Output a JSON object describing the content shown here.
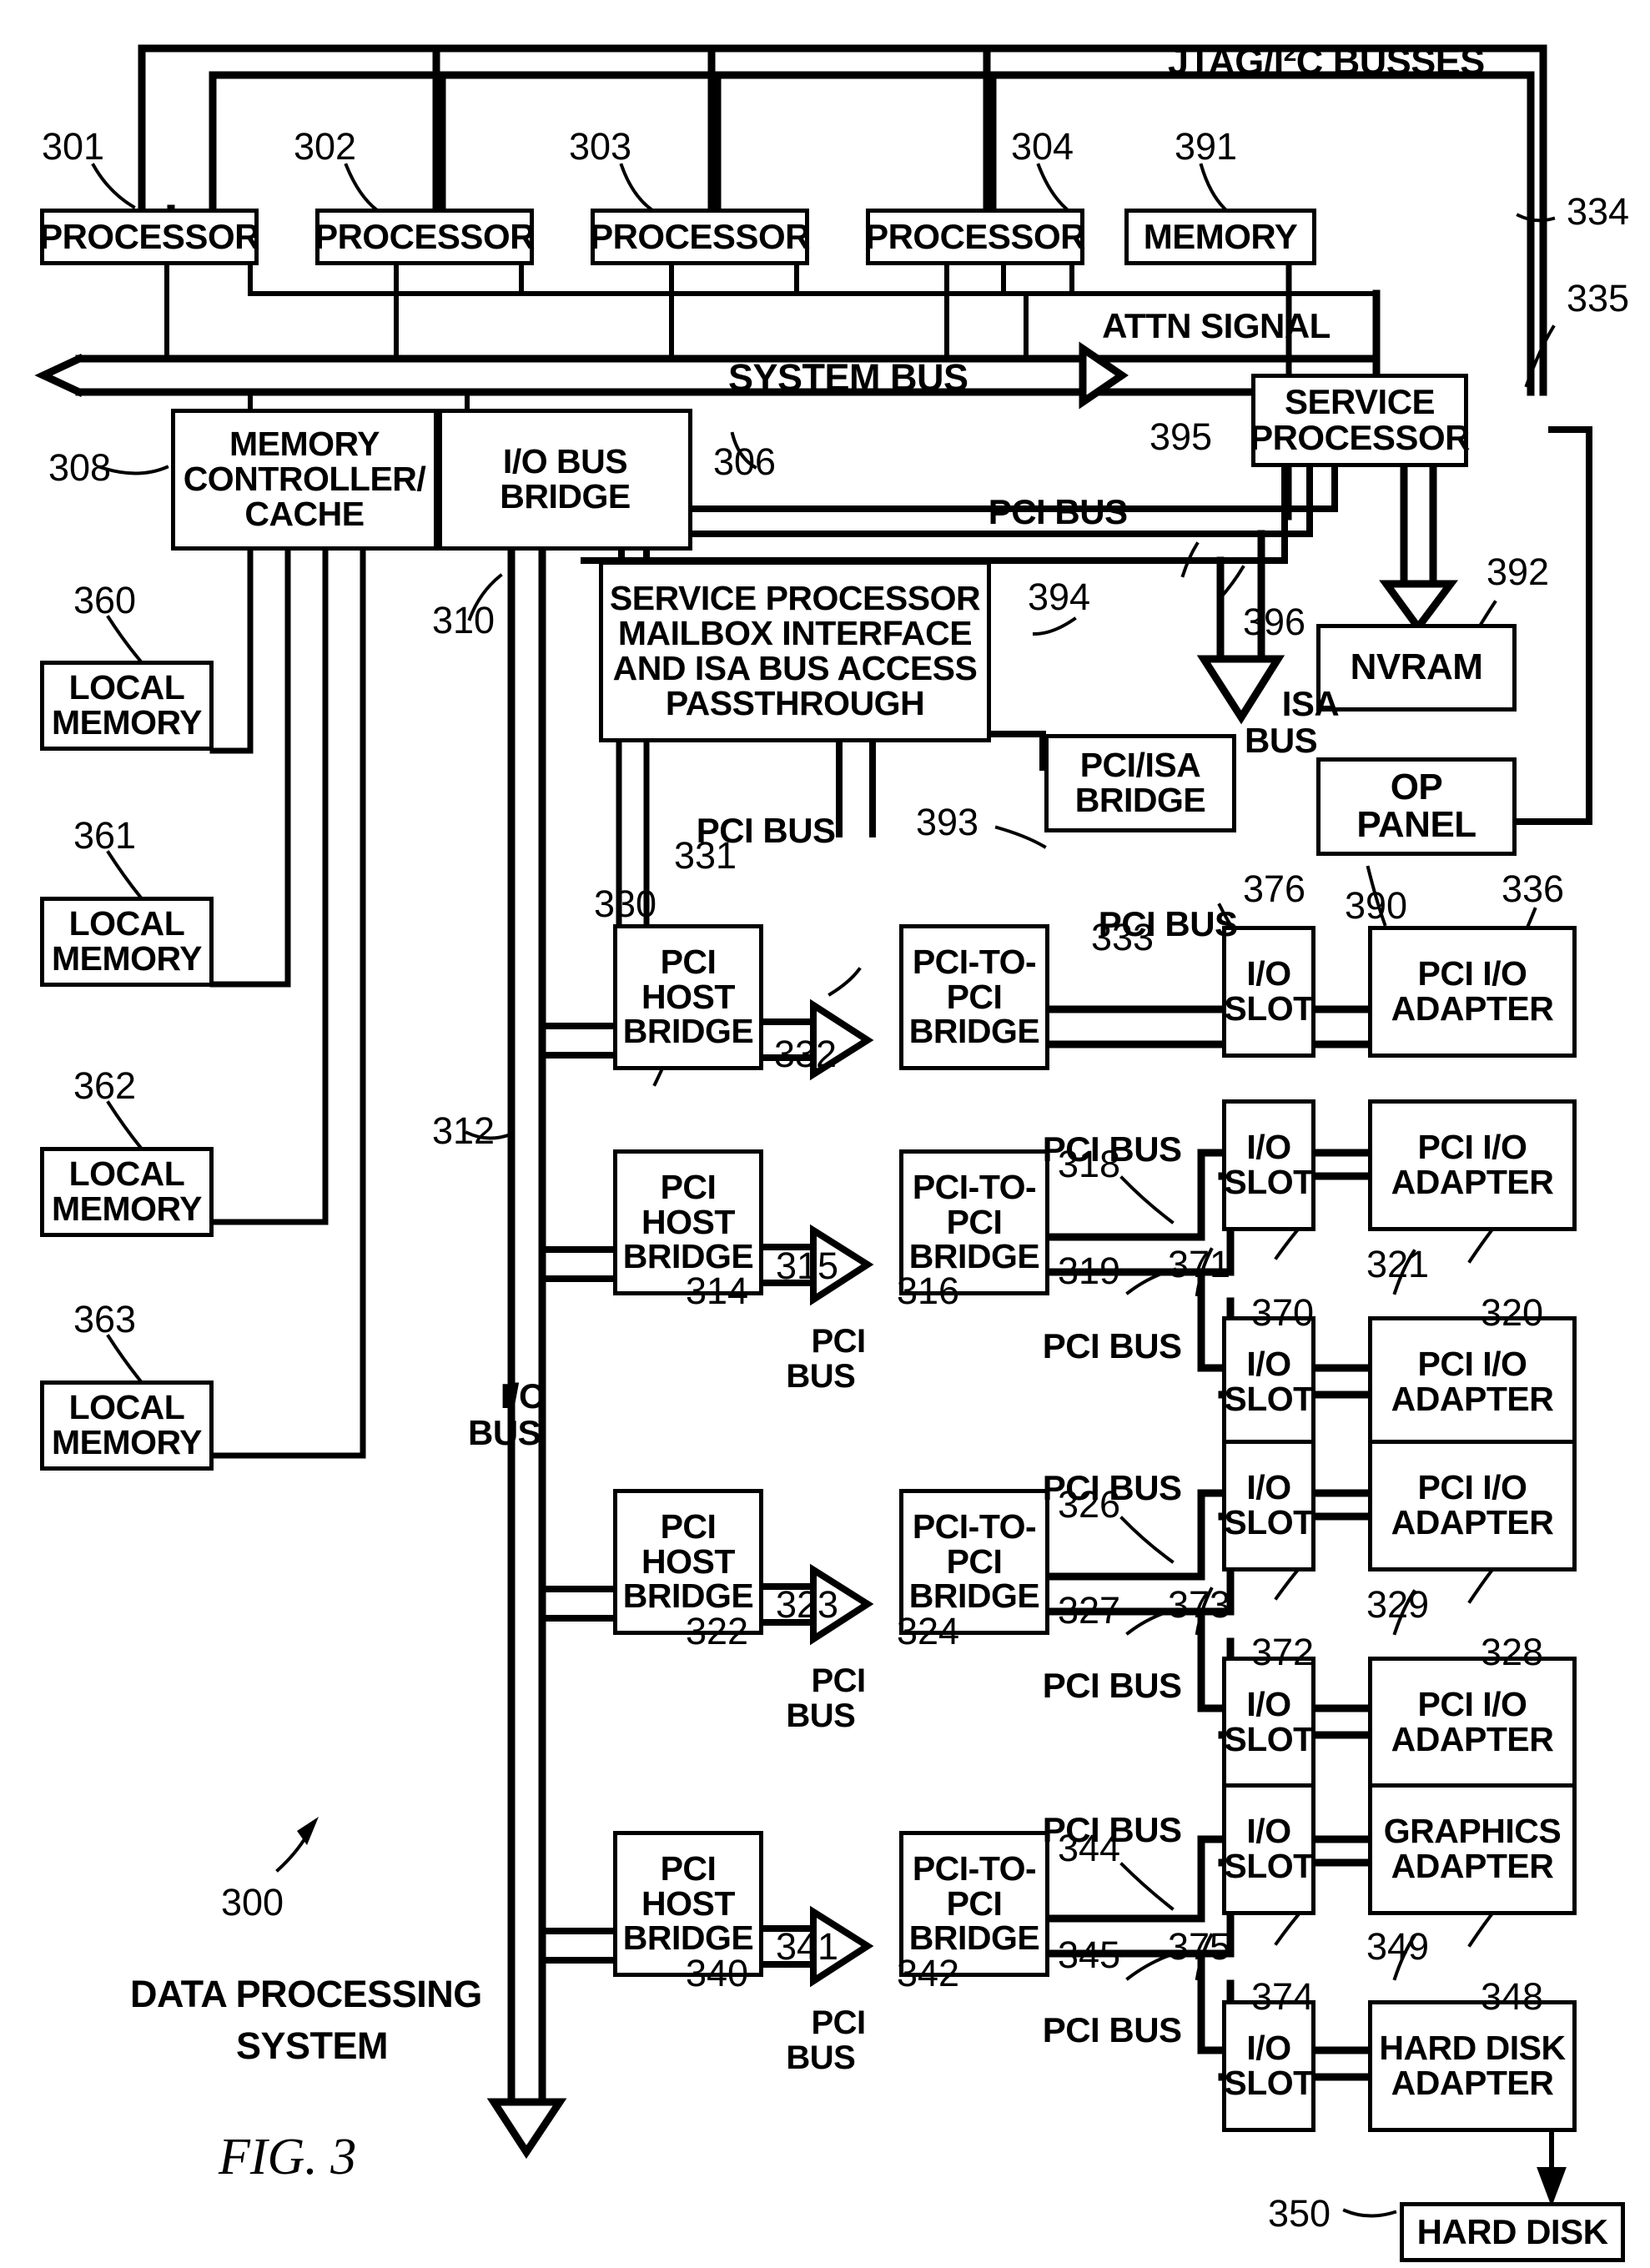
{
  "figure": {
    "caption": "FIG. 3",
    "system_ref": "300",
    "system_label_line1": "DATA PROCESSING",
    "system_label_line2": "SYSTEM"
  },
  "top": {
    "jtag_label_a": "JTAG/I",
    "jtag_label_sup": "2",
    "jtag_label_b": "C BUSSES",
    "attn_signal": "ATTN SIGNAL",
    "system_bus": "SYSTEM BUS",
    "io_bus": "I/O\nBUS"
  },
  "processors": [
    {
      "label": "PROCESSOR",
      "ref": "301"
    },
    {
      "label": "PROCESSOR",
      "ref": "302"
    },
    {
      "label": "PROCESSOR",
      "ref": "303"
    },
    {
      "label": "PROCESSOR",
      "ref": "304"
    }
  ],
  "memory_top": {
    "label": "MEMORY",
    "ref": "391"
  },
  "refs_right_top": {
    "bus334": "334",
    "bus335": "335"
  },
  "service_processor": {
    "label": "SERVICE\nPROCESSOR"
  },
  "memory_controller": {
    "label": "MEMORY\nCONTROLLER/\nCACHE",
    "ref": "308"
  },
  "io_bus_bridge": {
    "label": "I/O BUS\nBRIDGE",
    "ref": "306",
    "bus_ref_310": "310",
    "bus_ref_312": "312"
  },
  "mailbox": {
    "label": "SERVICE PROCESSOR\nMAILBOX INTERFACE\nAND ISA BUS ACCESS\nPASSTHROUGH",
    "ref": "394",
    "pci_bus_label": "PCI BUS",
    "pci_bus_ref": "331"
  },
  "pci_isa_bridge": {
    "label": "PCI/ISA\nBRIDGE",
    "ref": "393",
    "isa_ref": "396",
    "isa_label": "ISA\nBUS"
  },
  "nvram": {
    "label": "NVRAM",
    "ref": "392"
  },
  "op_panel": {
    "label": "OP\nPANEL",
    "ref": "390"
  },
  "pci_bus_395": {
    "label": "PCI BUS",
    "ref": "395"
  },
  "local_memories": [
    {
      "label": "LOCAL\nMEMORY",
      "ref": "360"
    },
    {
      "label": "LOCAL\nMEMORY",
      "ref": "361"
    },
    {
      "label": "LOCAL\nMEMORY",
      "ref": "362"
    },
    {
      "label": "LOCAL\nMEMORY",
      "ref": "363"
    }
  ],
  "pci_groups": [
    {
      "host_bridge": {
        "label": "PCI\nHOST\nBRIDGE",
        "ref": "330"
      },
      "mid_bus": {
        "ref": "332",
        "label": ""
      },
      "p2p_bridge": {
        "label": "PCI-TO-\nPCI\nBRIDGE",
        "ref": ""
      },
      "bus_top": {
        "label": "PCI BUS",
        "ref": "333"
      },
      "bus_bottom": {
        "label": "",
        "ref": ""
      },
      "rows": [
        {
          "slot": {
            "label": "I/O\nSLOT",
            "ref": "376"
          },
          "adapter": {
            "label": "PCI I/O\nADAPTER",
            "ref": "336"
          }
        }
      ]
    },
    {
      "host_bridge": {
        "label": "PCI\nHOST\nBRIDGE",
        "ref": "314"
      },
      "mid_bus": {
        "ref": "315",
        "label": "PCI\nBUS"
      },
      "p2p_bridge": {
        "label": "PCI-TO-\nPCI\nBRIDGE",
        "ref": "316"
      },
      "bus_top": {
        "label": "PCI BUS",
        "ref": "318"
      },
      "bus_bottom": {
        "label": "PCI BUS",
        "ref": "319"
      },
      "rows": [
        {
          "slot": {
            "label": "I/O\nSLOT",
            "ref": "370"
          },
          "adapter": {
            "label": "PCI I/O\nADAPTER",
            "ref": "320"
          }
        },
        {
          "slot": {
            "label": "I/O\nSLOT",
            "ref": "371"
          },
          "adapter": {
            "label": "PCI I/O\nADAPTER",
            "ref": "321"
          }
        }
      ]
    },
    {
      "host_bridge": {
        "label": "PCI\nHOST\nBRIDGE",
        "ref": "322"
      },
      "mid_bus": {
        "ref": "323",
        "label": "PCI\nBUS"
      },
      "p2p_bridge": {
        "label": "PCI-TO-\nPCI\nBRIDGE",
        "ref": "324"
      },
      "bus_top": {
        "label": "PCI BUS",
        "ref": "326"
      },
      "bus_bottom": {
        "label": "PCI BUS",
        "ref": "327"
      },
      "rows": [
        {
          "slot": {
            "label": "I/O\nSLOT",
            "ref": "372"
          },
          "adapter": {
            "label": "PCI I/O\nADAPTER",
            "ref": "328"
          }
        },
        {
          "slot": {
            "label": "I/O\nSLOT",
            "ref": "373"
          },
          "adapter": {
            "label": "PCI I/O\nADAPTER",
            "ref": "329"
          }
        }
      ]
    },
    {
      "host_bridge": {
        "label": "PCI\nHOST\nBRIDGE",
        "ref": "340"
      },
      "mid_bus": {
        "ref": "341",
        "label": "PCI\nBUS"
      },
      "p2p_bridge": {
        "label": "PCI-TO-\nPCI\nBRIDGE",
        "ref": "342"
      },
      "bus_top": {
        "label": "PCI BUS",
        "ref": "344"
      },
      "bus_bottom": {
        "label": "PCI BUS",
        "ref": "345"
      },
      "rows": [
        {
          "slot": {
            "label": "I/O\nSLOT",
            "ref": "374"
          },
          "adapter": {
            "label": "GRAPHICS\nADAPTER",
            "ref": "348"
          }
        },
        {
          "slot": {
            "label": "I/O\nSLOT",
            "ref": "375"
          },
          "adapter": {
            "label": "HARD DISK\nADAPTER",
            "ref": "349"
          }
        }
      ]
    }
  ],
  "hard_disk": {
    "label": "HARD DISK",
    "ref": "350"
  }
}
